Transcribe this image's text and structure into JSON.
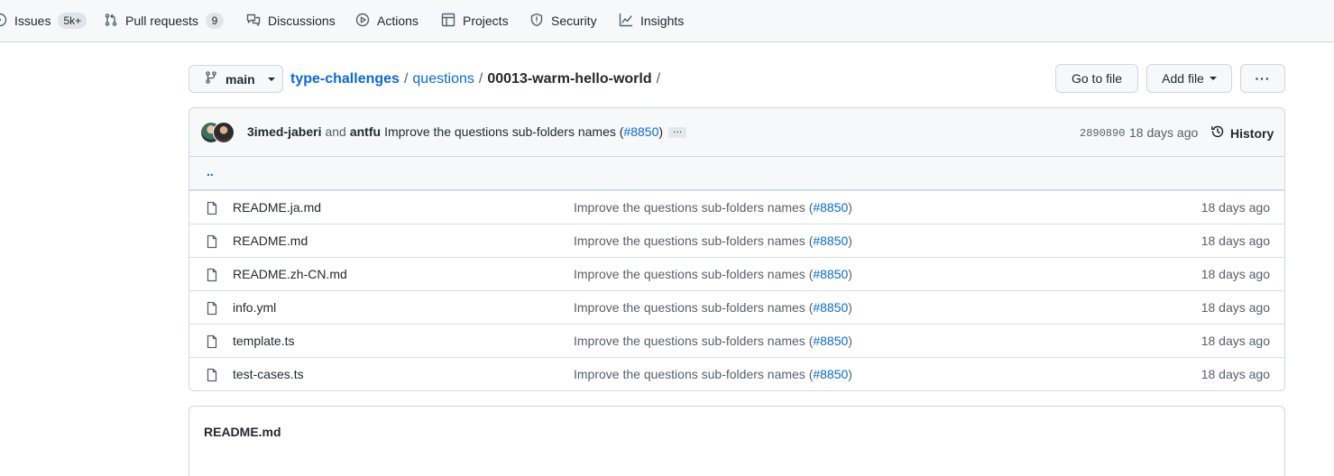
{
  "repo_nav": {
    "items": [
      {
        "label": "Issues",
        "icon": "issue-opened-icon",
        "count": "5k+"
      },
      {
        "label": "Pull requests",
        "icon": "git-pull-request-icon",
        "count": "9"
      },
      {
        "label": "Discussions",
        "icon": "comment-discussion-icon"
      },
      {
        "label": "Actions",
        "icon": "play-icon"
      },
      {
        "label": "Projects",
        "icon": "table-icon"
      },
      {
        "label": "Security",
        "icon": "shield-icon"
      },
      {
        "label": "Insights",
        "icon": "graph-icon"
      }
    ]
  },
  "branch": {
    "name": "main"
  },
  "breadcrumb": {
    "repo": "type-challenges",
    "folder": "questions",
    "current": "00013-warm-hello-world",
    "separator": "/"
  },
  "actions": {
    "go_to_file": "Go to file",
    "add_file": "Add file",
    "more": "···"
  },
  "latest_commit": {
    "author1": "3imed-jaberi",
    "and": "and",
    "author2": "antfu",
    "message": "Improve the questions sub-folders names (",
    "pr_link": "#8850",
    "message_end": ")",
    "ellipsis": "…",
    "sha": "2890890",
    "age": "18 days ago",
    "history_label": "History"
  },
  "parent_dir": "..",
  "files": [
    {
      "name": "README.ja.md",
      "msg": "Improve the questions sub-folders names (",
      "pr": "#8850",
      "msg_end": ")",
      "age": "18 days ago"
    },
    {
      "name": "README.md",
      "msg": "Improve the questions sub-folders names (",
      "pr": "#8850",
      "msg_end": ")",
      "age": "18 days ago"
    },
    {
      "name": "README.zh-CN.md",
      "msg": "Improve the questions sub-folders names (",
      "pr": "#8850",
      "msg_end": ")",
      "age": "18 days ago"
    },
    {
      "name": "info.yml",
      "msg": "Improve the questions sub-folders names (",
      "pr": "#8850",
      "msg_end": ")",
      "age": "18 days ago"
    },
    {
      "name": "template.ts",
      "msg": "Improve the questions sub-folders names (",
      "pr": "#8850",
      "msg_end": ")",
      "age": "18 days ago"
    },
    {
      "name": "test-cases.ts",
      "msg": "Improve the questions sub-folders names (",
      "pr": "#8850",
      "msg_end": ")",
      "age": "18 days ago"
    }
  ],
  "readme": {
    "title": "README.md"
  },
  "colors": {
    "link": "#0969da",
    "border": "#d0d7de",
    "muted": "#57606a",
    "subtle_bg": "#f6f8fa"
  }
}
